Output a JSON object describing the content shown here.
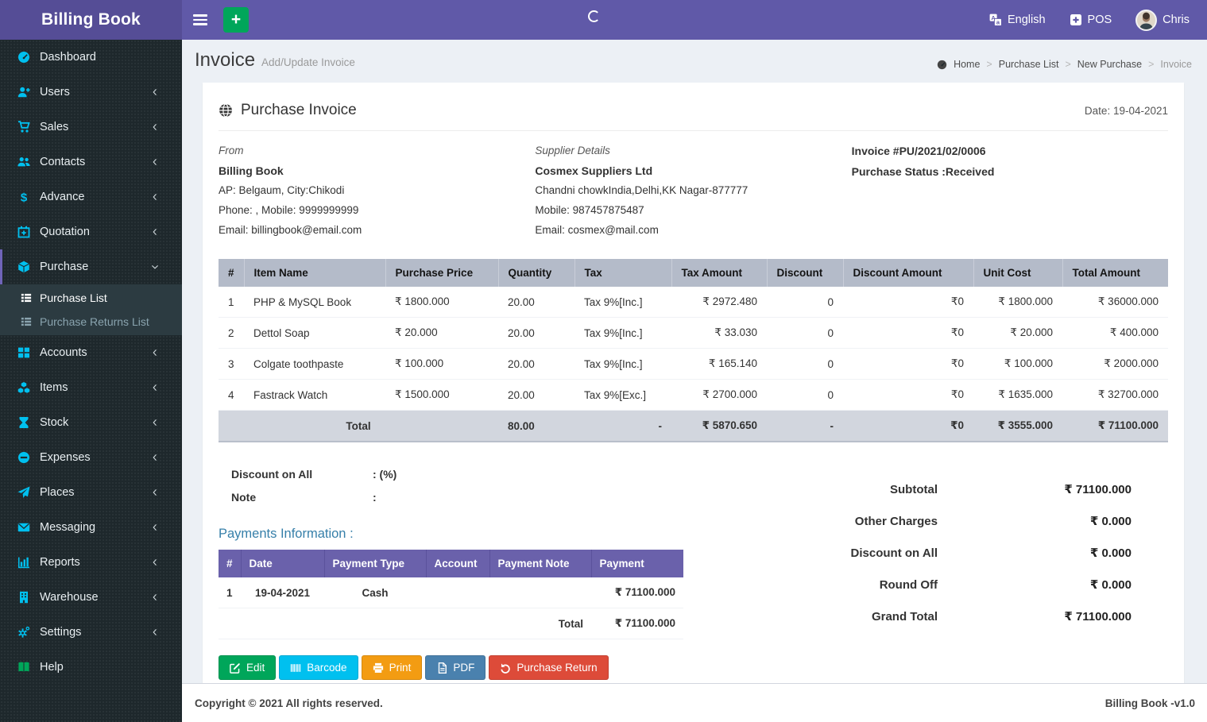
{
  "app": {
    "name": "Billing Book",
    "version": "Billing Book -v1.0",
    "copyright": "Copyright © 2021 All rights reserved."
  },
  "navbar": {
    "language": "English",
    "pos_label": "POS",
    "username": "Chris"
  },
  "sidebar": {
    "items": [
      {
        "label": "Dashboard",
        "icon": "gauge"
      },
      {
        "label": "Users",
        "icon": "user-plus"
      },
      {
        "label": "Sales",
        "icon": "cart"
      },
      {
        "label": "Contacts",
        "icon": "users"
      },
      {
        "label": "Advance",
        "icon": "dollar"
      },
      {
        "label": "Quotation",
        "icon": "calendar-plus"
      },
      {
        "label": "Purchase",
        "icon": "cube",
        "state": "expanded"
      },
      {
        "label": "Accounts",
        "icon": "th-large"
      },
      {
        "label": "Items",
        "icon": "cubes"
      },
      {
        "label": "Stock",
        "icon": "hourglass"
      },
      {
        "label": "Expenses",
        "icon": "minus-circle"
      },
      {
        "label": "Places",
        "icon": "paper-plane"
      },
      {
        "label": "Messaging",
        "icon": "envelope"
      },
      {
        "label": "Reports",
        "icon": "bar-chart"
      },
      {
        "label": "Warehouse",
        "icon": "building"
      },
      {
        "label": "Settings",
        "icon": "gears"
      },
      {
        "label": "Help",
        "icon": "book"
      }
    ],
    "submenu": [
      {
        "label": "Purchase List",
        "icon": "list",
        "state": "current"
      },
      {
        "label": "Purchase Returns List",
        "icon": "list"
      }
    ]
  },
  "page": {
    "title": "Invoice",
    "subtitle": "Add/Update Invoice",
    "breadcrumb": [
      "Home",
      "Purchase List",
      "New Purchase",
      "Invoice"
    ]
  },
  "invoice": {
    "card_title": "Purchase Invoice",
    "date_label": "Date: 19-04-2021",
    "from": {
      "heading": "From",
      "name": "Billing Book",
      "address": "AP: Belgaum, City:Chikodi",
      "phone": "Phone: , Mobile: 9999999999",
      "email": "Email: billingbook@email.com"
    },
    "supplier": {
      "heading": "Supplier Details",
      "name": "Cosmex Suppliers Ltd",
      "address": "Chandni chowkIndia,Delhi,KK Nagar-877777",
      "phone": "Mobile: 987457875487",
      "email": "Email: cosmex@mail.com"
    },
    "meta": {
      "number": "Invoice #PU/2021/02/0006",
      "status": "Purchase Status :Received"
    }
  },
  "items_table": {
    "headers": [
      "#",
      "Item Name",
      "Purchase Price",
      "Quantity",
      "Tax",
      "Tax Amount",
      "Discount",
      "Discount Amount",
      "Unit Cost",
      "Total Amount"
    ],
    "rows": [
      [
        "1",
        "PHP & MySQL Book",
        "₹ 1800.000",
        "20.00",
        "Tax 9%[Inc.]",
        "₹ 2972.480",
        "0",
        "₹0",
        "₹ 1800.000",
        "₹ 36000.000"
      ],
      [
        "2",
        "Dettol Soap",
        "₹ 20.000",
        "20.00",
        "Tax 9%[Inc.]",
        "₹ 33.030",
        "0",
        "₹0",
        "₹ 20.000",
        "₹ 400.000"
      ],
      [
        "3",
        "Colgate toothpaste",
        "₹ 100.000",
        "20.00",
        "Tax 9%[Inc.]",
        "₹ 165.140",
        "0",
        "₹0",
        "₹ 100.000",
        "₹ 2000.000"
      ],
      [
        "4",
        "Fastrack Watch",
        "₹ 1500.000",
        "20.00",
        "Tax 9%[Exc.]",
        "₹ 2700.000",
        "0",
        "₹0",
        "₹ 1635.000",
        "₹ 32700.000"
      ]
    ],
    "total_row": {
      "label": "Total",
      "quantity": "80.00",
      "tax": "-",
      "tax_amount": "₹ 5870.650",
      "discount": "-",
      "discount_amount": "₹0",
      "unit_cost": "₹ 3555.000",
      "total_amount": "₹ 71100.000"
    }
  },
  "notes": {
    "discount_label": "Discount on All",
    "discount_value": ": (%)",
    "note_label": "Note",
    "note_value": ":"
  },
  "payments": {
    "heading": "Payments Information :",
    "headers": [
      "#",
      "Date",
      "Payment Type",
      "Account",
      "Payment Note",
      "Payment"
    ],
    "rows": [
      [
        "1",
        "19-04-2021",
        "Cash",
        "",
        "",
        "₹ 71100.000"
      ]
    ],
    "total_label": "Total",
    "total_value": "₹ 71100.000"
  },
  "summary": {
    "rows": [
      [
        "Subtotal",
        "₹ 71100.000"
      ],
      [
        "Other Charges",
        "₹ 0.000"
      ],
      [
        "Discount on All",
        "₹ 0.000"
      ],
      [
        "Round Off",
        "₹ 0.000"
      ],
      [
        "Grand Total",
        "₹ 71100.000"
      ]
    ]
  },
  "actions": {
    "edit": "Edit",
    "barcode": "Barcode",
    "print": "Print",
    "pdf": "PDF",
    "purchase_return": "Purchase Return"
  },
  "colors": {
    "navbar": "#6059a8",
    "logo_bg": "#554d96",
    "sidebar_bg": "#1e282c",
    "sidebar_icon": "#00c0ef",
    "table_header": "#b4bbc9",
    "payments_header": "#6a61ab",
    "green": "#00a65a",
    "cyan": "#00c0ef",
    "orange": "#f39c12",
    "steel_blue": "#4a81ae",
    "red": "#dd4b39",
    "heading_teal": "#367fa9"
  }
}
